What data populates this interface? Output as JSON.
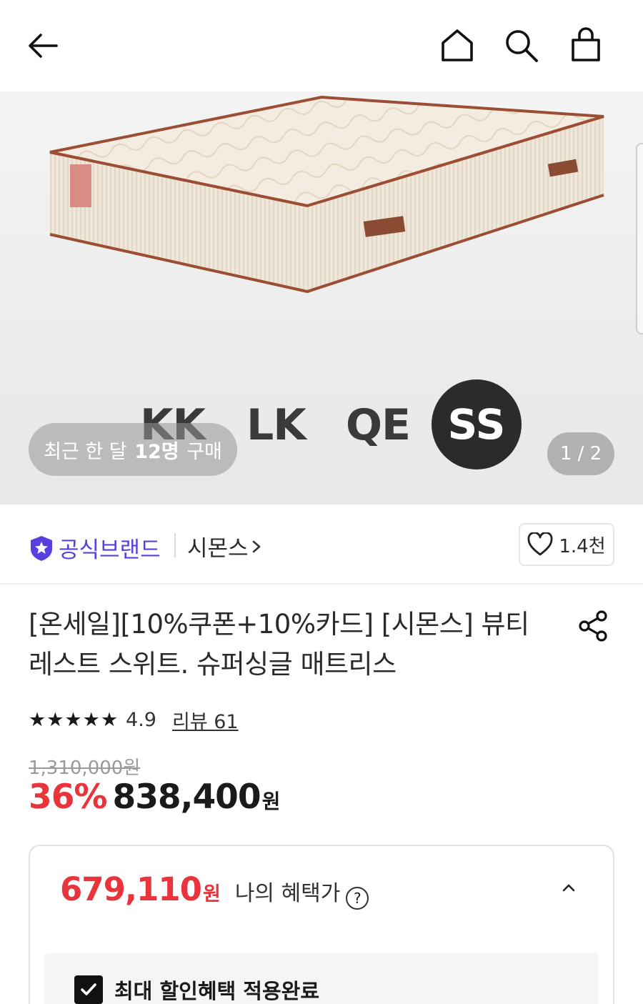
{
  "gallery": {
    "sizes": [
      "KK",
      "LK",
      "QE",
      "SS"
    ],
    "buy_prefix": "최근 한 달",
    "buy_count": "12명",
    "buy_suffix": "구매",
    "page_indicator": "1 / 2"
  },
  "brand": {
    "badge_label": "공식브랜드",
    "name": "시몬스",
    "likes": "1.4천"
  },
  "product": {
    "title": "[온세일][10%쿠폰+10%카드] [시몬스] 뷰티레스트 스위트. 슈퍼싱글 매트리스",
    "rating": "4.9",
    "stars": "★★★★★",
    "reviews": "리뷰 61",
    "original_price": "1,310,000원",
    "discount": "36%",
    "sale_price": "838,400",
    "currency": "원"
  },
  "benefit": {
    "price": "679,110",
    "currency": "원",
    "label": "나의 혜택가",
    "help": "?",
    "check_label": "최대 할인혜택 적용완료"
  },
  "icons": [
    "back-arrow-icon",
    "home-icon",
    "search-icon",
    "cart-icon",
    "heart-icon",
    "share-icon",
    "star-badge-icon",
    "chevron-right-icon",
    "chevron-up-icon",
    "checkmark-icon"
  ],
  "colors": {
    "accent_red": "#e8343a",
    "brand_purple": "#5a3fe0"
  }
}
